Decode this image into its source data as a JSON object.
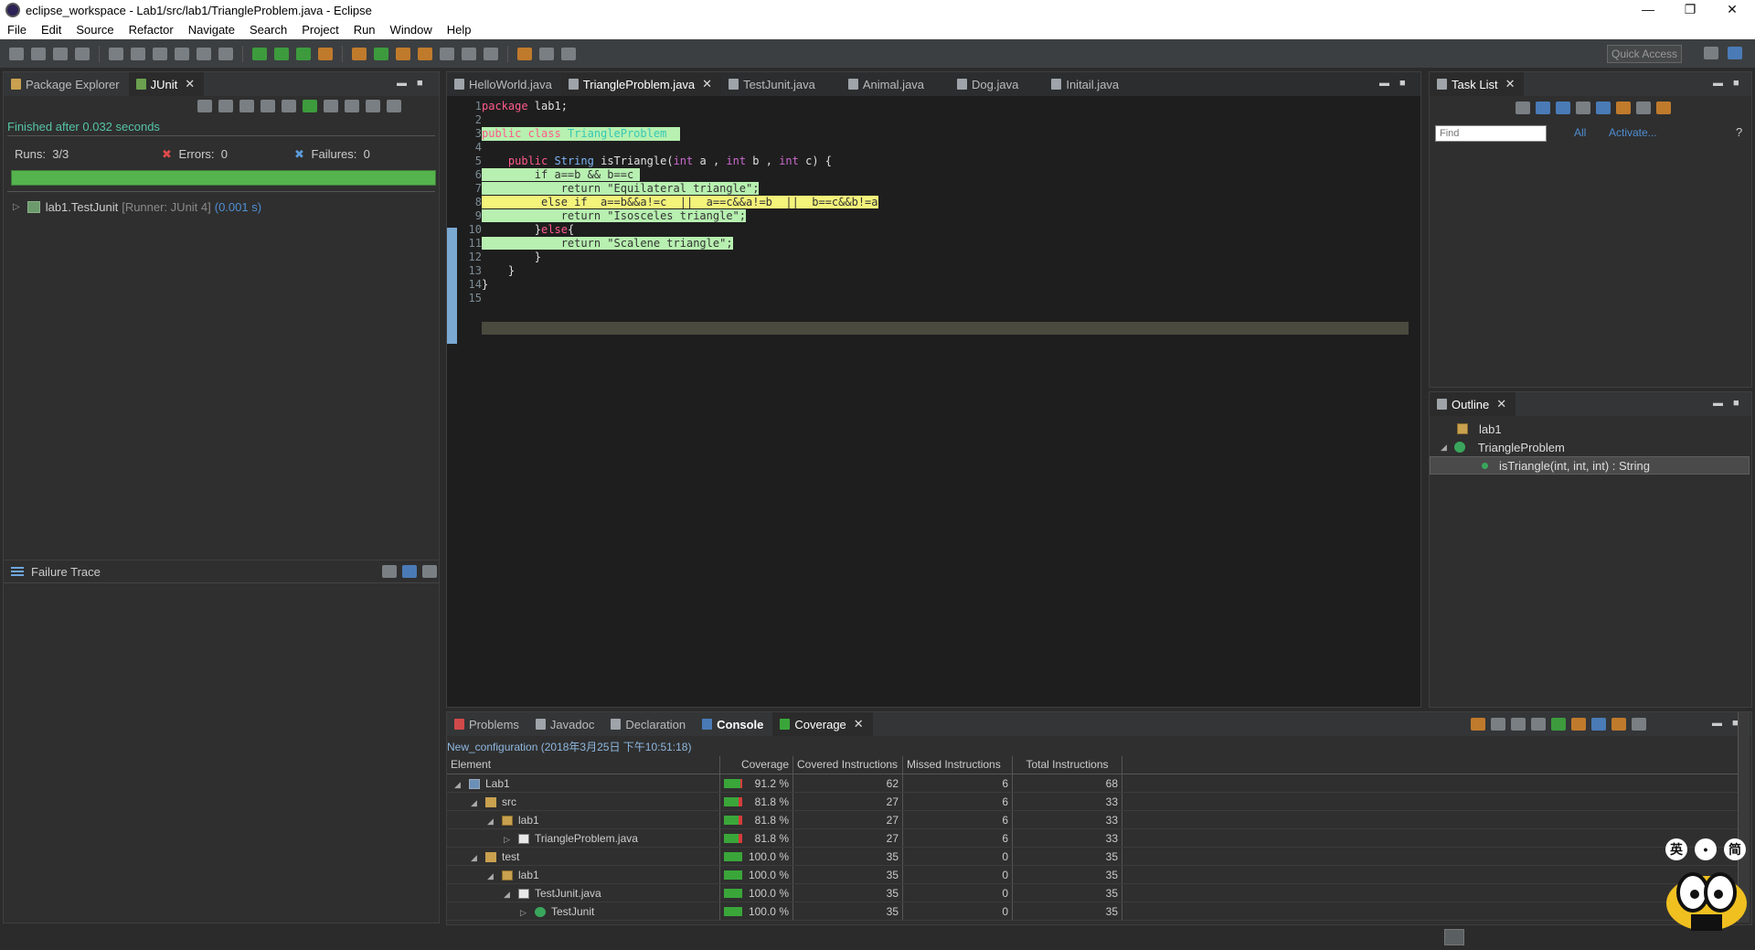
{
  "window": {
    "title": "eclipse_workspace - Lab1/src/lab1/TriangleProblem.java - Eclipse",
    "minimize": "—",
    "restore": "❐",
    "close": "✕"
  },
  "menu": [
    "File",
    "Edit",
    "Source",
    "Refactor",
    "Navigate",
    "Search",
    "Project",
    "Run",
    "Window",
    "Help"
  ],
  "toolbar": {
    "quick_access": "Quick Access"
  },
  "left_tabs": [
    {
      "label": "Package Explorer",
      "icon": "package-explorer-icon"
    },
    {
      "label": "JUnit",
      "icon": "junit-icon",
      "active": true
    }
  ],
  "junit": {
    "finished": "Finished after 0.032 seconds",
    "runs_label": "Runs:",
    "runs": "3/3",
    "errors_label": "Errors:",
    "errors": "0",
    "failures_label": "Failures:",
    "failures": "0",
    "bar_color": "#55b44d",
    "suite": "lab1.TestJunit",
    "runner": "[Runner: JUnit 4]",
    "time": "(0.001 s)"
  },
  "failure_trace": {
    "label": "Failure Trace"
  },
  "editor_tabs": [
    {
      "label": "HelloWorld.java"
    },
    {
      "label": "TriangleProblem.java",
      "active": true
    },
    {
      "label": "TestJunit.java"
    },
    {
      "label": "Animal.java"
    },
    {
      "label": "Dog.java"
    },
    {
      "label": "Initail.java"
    }
  ],
  "code": {
    "lines": [
      "1",
      "2",
      "3",
      "4",
      "5",
      "6",
      "7",
      "8",
      "9",
      "10",
      "11",
      "12",
      "13",
      "14",
      "15"
    ],
    "l1_kw": "package",
    "l1_rest": " lab1;",
    "l3_kw": "public class",
    "l3_cls": "TriangleProblem",
    "l5_kw": "public",
    "l5_typ": "String",
    "l5_name": "isTriangle(",
    "l5_int1": "int",
    "l5_a": " a , ",
    "l5_int2": "int",
    "l5_b": " b , ",
    "l5_int3": "int",
    "l5_c": " c) {",
    "l6_kw": "if",
    "l6_cond": " a==b && b==c",
    "l7_kw": "return",
    "l7_str": " \"Equilateral triangle\";",
    "l8_kw": "else if",
    "l8_cond": "  a==b&&a!=c  ||  a==c&&a!=b  ||  b==c&&b!=a",
    "l9_kw": "return",
    "l9_str": " \"Isosceles triangle\";",
    "l10_open": "}",
    "l10_kw": "else",
    "l10_brace": "{",
    "l11_kw": "return",
    "l11_str": " \"Scalene triangle\";",
    "l12": "}",
    "l13": "}",
    "l14": "}"
  },
  "task_list": {
    "label": "Task List",
    "filter_placeholder": "Find",
    "all": "All",
    "activate": "Activate..."
  },
  "outline": {
    "label": "Outline",
    "package": "lab1",
    "class": "TriangleProblem",
    "method": "isTriangle(int, int, int) : String"
  },
  "bottom_tabs": [
    {
      "label": "Problems",
      "icon": "problems-icon"
    },
    {
      "label": "Javadoc",
      "icon": "javadoc-icon"
    },
    {
      "label": "Declaration",
      "icon": "declaration-icon"
    },
    {
      "label": "Console",
      "icon": "console-icon"
    },
    {
      "label": "Coverage",
      "icon": "coverage-icon",
      "active": true
    }
  ],
  "coverage": {
    "session": "New_configuration (2018年3月25日 下午10:51:18)",
    "headers": [
      "Element",
      "Coverage",
      "Covered Instructions",
      "Missed Instructions",
      "Total Instructions"
    ],
    "rows": [
      {
        "name": "Lab1",
        "type": "project",
        "expand": "◢",
        "coverage": "91.2 %",
        "covered": "62",
        "missed": "6",
        "total": "68",
        "fraction": 0.912
      },
      {
        "name": "src",
        "type": "folder",
        "expand": "◢",
        "coverage": "81.8 %",
        "covered": "27",
        "missed": "6",
        "total": "33",
        "fraction": 0.818
      },
      {
        "name": "lab1",
        "type": "package",
        "expand": "◢",
        "coverage": "81.8 %",
        "covered": "27",
        "missed": "6",
        "total": "33",
        "fraction": 0.818
      },
      {
        "name": "TriangleProblem.java",
        "type": "file",
        "expand": "▷",
        "coverage": "81.8 %",
        "covered": "27",
        "missed": "6",
        "total": "33",
        "fraction": 0.818
      },
      {
        "name": "test",
        "type": "folder",
        "expand": "◢",
        "coverage": "100.0 %",
        "covered": "35",
        "missed": "0",
        "total": "35",
        "fraction": 1.0
      },
      {
        "name": "lab1",
        "type": "package",
        "expand": "◢",
        "coverage": "100.0 %",
        "covered": "35",
        "missed": "0",
        "total": "35",
        "fraction": 1.0
      },
      {
        "name": "TestJunit.java",
        "type": "file",
        "expand": "◢",
        "coverage": "100.0 %",
        "covered": "35",
        "missed": "0",
        "total": "35",
        "fraction": 1.0
      },
      {
        "name": "TestJunit",
        "type": "class",
        "expand": "▷",
        "coverage": "100.0 %",
        "covered": "35",
        "missed": "0",
        "total": "35",
        "fraction": 1.0
      }
    ]
  },
  "ime": [
    "英",
    "•",
    "简"
  ]
}
